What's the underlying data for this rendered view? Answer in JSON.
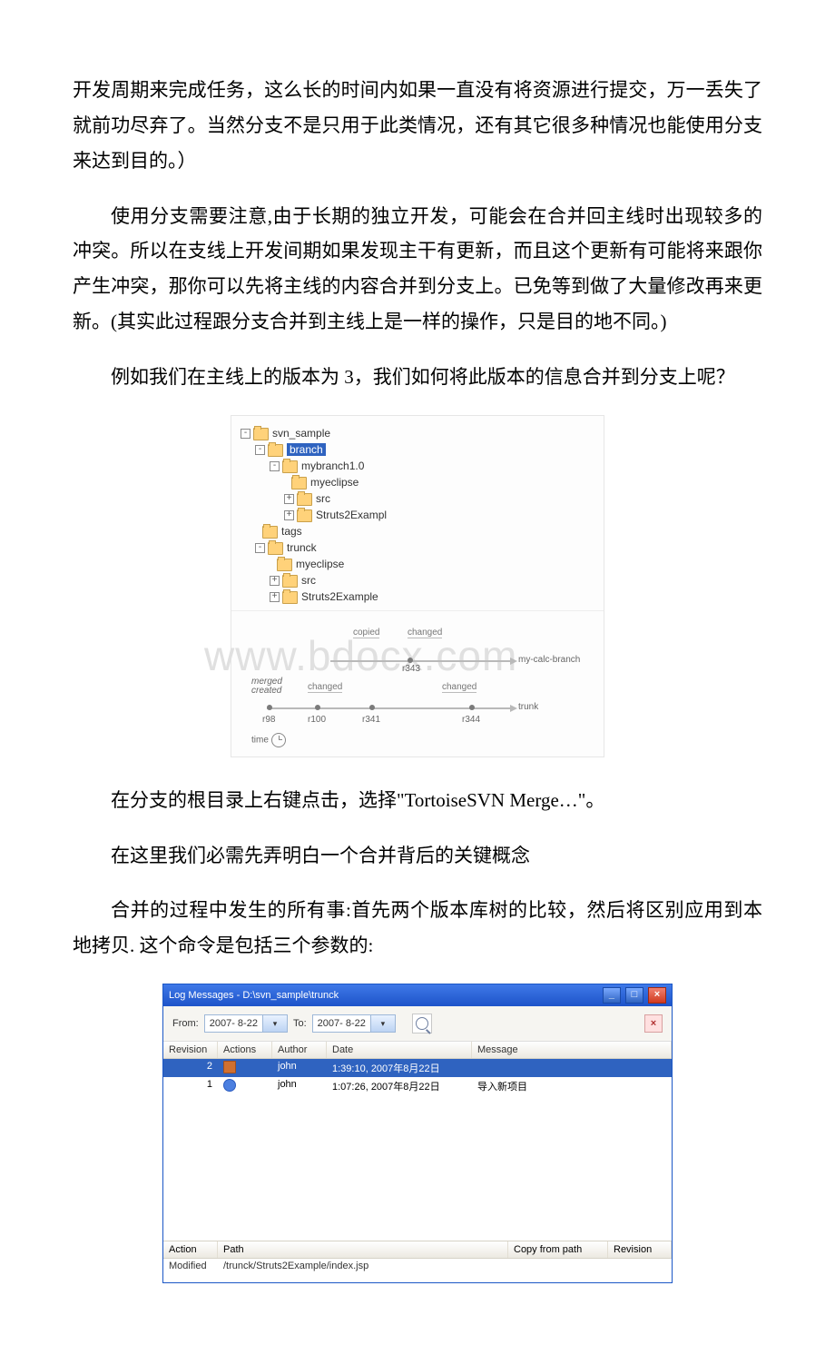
{
  "para1": "开发周期来完成任务，这么长的时间内如果一直没有将资源进行提交，万一丢失了就前功尽弃了。当然分支不是只用于此类情况，还有其它很多种情况也能使用分支来达到目的。）",
  "para2": "使用分支需要注意,由于长期的独立开发，可能会在合并回主线时出现较多的冲突。所以在支线上开发间期如果发现主干有更新，而且这个更新有可能将来跟你产生冲突，那你可以先将主线的内容合并到分支上。已免等到做了大量修改再来更新。(其实此过程跟分支合并到主线上是一样的操作，只是目的地不同。)",
  "para3": "例如我们在主线上的版本为 3，我们如何将此版本的信息合并到分支上呢？",
  "para4_a": "在分支的根目录上右键点击，选择",
  "para4_b": "\"TortoiseSVN Merge…\"",
  "para4_c": "。",
  "para5": "在这里我们必需先弄明白一个合并背后的关键概念",
  "para6": "合并的过程中发生的所有事:首先两个版本库树的比较，然后将区别应用到本地拷贝. 这个命令是包括三个参数的:",
  "tree": {
    "root": "svn_sample",
    "branch": "branch",
    "mybranch": "mybranch1.0",
    "myeclipse": "myeclipse",
    "src": "src",
    "struts": "Struts2Exampl",
    "tags": "tags",
    "trunck": "trunck",
    "myeclipse2": "myeclipse",
    "src2": "src",
    "struts2": "Struts2Example"
  },
  "timeline": {
    "watermark": "www.bdocx.com",
    "copied": "copied",
    "changed": "changed",
    "mybranch": "my-calc-branch",
    "merged": "merged",
    "created": "created",
    "trunk": "trunk",
    "r98": "r98",
    "r100": "r100",
    "r341": "r341",
    "r343": "r343",
    "r344": "r344",
    "time": "time"
  },
  "win": {
    "title": "Log Messages - D:\\svn_sample\\trunck",
    "from": "From:",
    "to": "To:",
    "date1": "2007- 8-22",
    "date2": "2007- 8-22",
    "cols": {
      "rev": "Revision",
      "actions": "Actions",
      "author": "Author",
      "date": "Date",
      "msg": "Message"
    },
    "rows": [
      {
        "rev": "2",
        "author": "john",
        "date": "1:39:10, 2007年8月22日",
        "msg": ""
      },
      {
        "rev": "1",
        "author": "john",
        "date": "1:07:26, 2007年8月22日",
        "msg": "导入新项目"
      }
    ],
    "bottom": {
      "action": "Action",
      "path": "Path",
      "copy": "Copy from path",
      "rev": "Revision",
      "rowAction": "Modified",
      "rowPath": "/trunck/Struts2Example/index.jsp"
    }
  }
}
